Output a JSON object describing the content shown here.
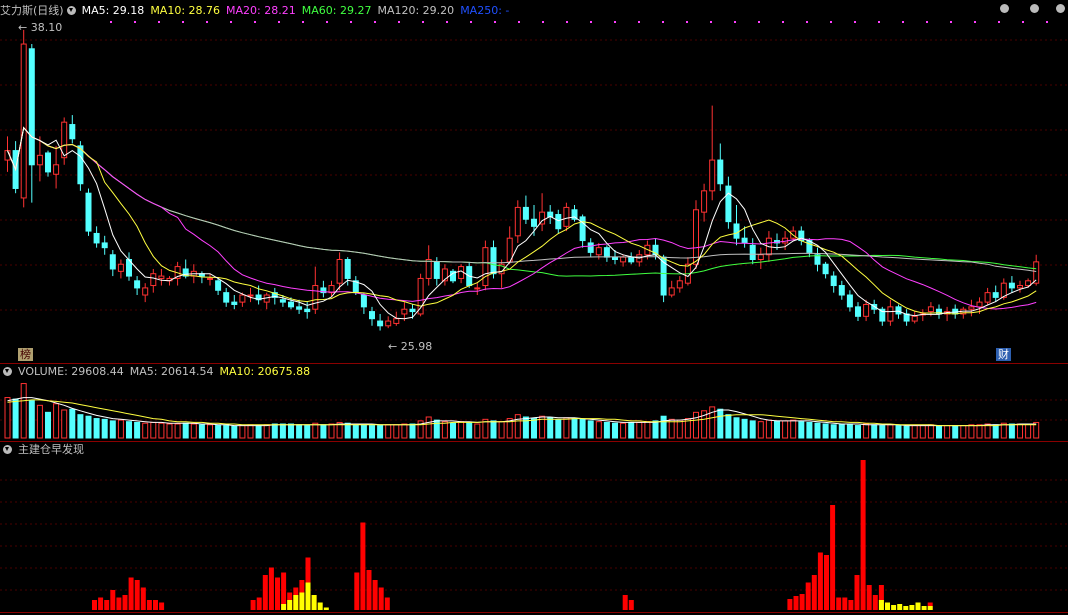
{
  "title": "艾力斯(日线)",
  "ma_legend": [
    {
      "label": "MA5: 29.18",
      "color": "#ffffff"
    },
    {
      "label": "MA10: 28.76",
      "color": "#ffff40"
    },
    {
      "label": "MA20: 28.21",
      "color": "#ff40ff"
    },
    {
      "label": "MA60: 29.27",
      "color": "#40ff40"
    },
    {
      "label": "MA120: 29.20",
      "color": "#c0c0c0"
    },
    {
      "label": "MA250: -",
      "color": "#2050ff"
    }
  ],
  "price_high": "38.10",
  "price_low": "25.98",
  "badge_left": "榜",
  "badge_right": "财",
  "volume_legend": [
    {
      "label": "VOLUME: 29608.44",
      "color": "#c0c0c0"
    },
    {
      "label": "MA5: 20614.54",
      "color": "#c0c0c0"
    },
    {
      "label": "MA10: 20675.88",
      "color": "#ffff40"
    }
  ],
  "indicator_title": "主建仓早发现",
  "colors": {
    "up": "#ff3232",
    "down": "#54ffff",
    "ind_red": "#ff0000",
    "ind_yellow": "#ffff00"
  },
  "chart_data": {
    "type": "candlestick",
    "ohlc": [
      [
        32.6,
        33.6,
        32.1,
        33.0
      ],
      [
        33.0,
        33.4,
        31.2,
        31.4
      ],
      [
        31.0,
        38.1,
        30.6,
        37.5
      ],
      [
        37.3,
        37.5,
        30.8,
        32.4
      ],
      [
        32.4,
        33.6,
        31.7,
        32.8
      ],
      [
        32.9,
        33.0,
        31.9,
        32.1
      ],
      [
        32.0,
        33.2,
        31.4,
        32.4
      ],
      [
        32.7,
        34.4,
        32.4,
        34.2
      ],
      [
        34.1,
        34.5,
        33.3,
        33.5
      ],
      [
        33.2,
        33.4,
        31.3,
        31.6
      ],
      [
        31.2,
        31.4,
        29.4,
        29.6
      ],
      [
        29.5,
        29.8,
        28.9,
        29.1
      ],
      [
        29.1,
        29.4,
        28.6,
        28.9
      ],
      [
        28.6,
        28.8,
        27.7,
        28.0
      ],
      [
        27.9,
        28.4,
        27.6,
        28.2
      ],
      [
        28.4,
        28.7,
        27.5,
        27.7
      ],
      [
        27.5,
        27.7,
        26.9,
        27.2
      ],
      [
        26.9,
        27.4,
        26.6,
        27.2
      ],
      [
        27.3,
        28.0,
        27.0,
        27.8
      ],
      [
        27.6,
        28.0,
        27.3,
        27.7
      ],
      [
        27.5,
        27.7,
        27.3,
        27.6
      ],
      [
        27.6,
        28.3,
        27.3,
        28.1
      ],
      [
        28.0,
        28.4,
        27.6,
        27.7
      ],
      [
        27.7,
        28.2,
        27.4,
        27.9
      ],
      [
        27.8,
        27.9,
        27.4,
        27.7
      ],
      [
        27.6,
        27.8,
        27.3,
        27.6
      ],
      [
        27.5,
        27.6,
        26.9,
        27.1
      ],
      [
        27.0,
        27.2,
        26.4,
        26.6
      ],
      [
        26.6,
        26.9,
        26.3,
        26.5
      ],
      [
        26.6,
        27.0,
        26.4,
        26.9
      ],
      [
        26.9,
        27.2,
        26.6,
        26.9
      ],
      [
        26.9,
        27.3,
        26.5,
        26.7
      ],
      [
        26.6,
        27.0,
        26.3,
        26.9
      ],
      [
        27.0,
        27.2,
        26.5,
        26.8
      ],
      [
        26.7,
        26.9,
        26.4,
        26.6
      ],
      [
        26.6,
        26.8,
        26.3,
        26.4
      ],
      [
        26.4,
        26.7,
        26.1,
        26.3
      ],
      [
        26.3,
        26.6,
        25.9,
        26.2
      ],
      [
        26.3,
        28.1,
        26.1,
        27.3
      ],
      [
        27.2,
        27.5,
        26.8,
        27.0
      ],
      [
        27.0,
        27.5,
        26.8,
        27.3
      ],
      [
        27.4,
        28.7,
        27.1,
        28.4
      ],
      [
        28.4,
        28.5,
        27.3,
        27.6
      ],
      [
        27.5,
        27.7,
        26.9,
        27.0
      ],
      [
        26.9,
        27.0,
        26.1,
        26.4
      ],
      [
        26.2,
        26.4,
        25.6,
        25.9
      ],
      [
        25.8,
        26.1,
        25.4,
        25.6
      ],
      [
        25.6,
        26.0,
        25.5,
        25.8
      ],
      [
        25.7,
        26.2,
        25.6,
        25.9
      ],
      [
        26.1,
        26.6,
        25.8,
        26.3
      ],
      [
        26.3,
        26.5,
        25.9,
        26.2
      ],
      [
        26.1,
        27.8,
        26.0,
        27.6
      ],
      [
        27.6,
        29.0,
        27.3,
        28.4
      ],
      [
        28.3,
        28.5,
        27.3,
        27.6
      ],
      [
        27.5,
        28.2,
        27.3,
        28.0
      ],
      [
        27.9,
        28.0,
        27.4,
        27.5
      ],
      [
        27.6,
        28.2,
        27.4,
        28.1
      ],
      [
        28.1,
        28.3,
        27.2,
        27.3
      ],
      [
        27.2,
        27.4,
        26.9,
        27.2
      ],
      [
        27.3,
        29.2,
        27.1,
        28.9
      ],
      [
        28.9,
        29.2,
        27.6,
        27.8
      ],
      [
        27.8,
        28.4,
        27.2,
        28.2
      ],
      [
        28.3,
        29.8,
        28.2,
        29.3
      ],
      [
        29.4,
        30.9,
        29.1,
        30.6
      ],
      [
        30.6,
        31.1,
        29.9,
        30.1
      ],
      [
        30.1,
        30.7,
        29.4,
        29.8
      ],
      [
        29.9,
        31.2,
        29.6,
        30.4
      ],
      [
        30.4,
        30.7,
        29.9,
        30.2
      ],
      [
        30.3,
        30.5,
        29.5,
        29.7
      ],
      [
        29.8,
        30.8,
        29.6,
        30.6
      ],
      [
        30.5,
        30.7,
        30.0,
        30.1
      ],
      [
        30.2,
        30.3,
        28.9,
        29.2
      ],
      [
        29.1,
        29.3,
        28.5,
        28.7
      ],
      [
        28.6,
        29.1,
        28.4,
        28.9
      ],
      [
        28.9,
        29.0,
        28.3,
        28.5
      ],
      [
        28.5,
        28.8,
        28.2,
        28.4
      ],
      [
        28.3,
        28.6,
        28.1,
        28.5
      ],
      [
        28.5,
        28.7,
        28.2,
        28.3
      ],
      [
        28.3,
        28.8,
        28.1,
        28.6
      ],
      [
        28.6,
        29.2,
        28.4,
        29.0
      ],
      [
        29.0,
        29.3,
        28.4,
        28.6
      ],
      [
        28.5,
        28.6,
        26.6,
        26.9
      ],
      [
        26.9,
        27.5,
        26.8,
        27.2
      ],
      [
        27.2,
        27.7,
        27.0,
        27.5
      ],
      [
        27.4,
        28.5,
        27.3,
        28.2
      ],
      [
        28.2,
        30.9,
        28.0,
        30.5
      ],
      [
        30.4,
        31.6,
        30.0,
        31.3
      ],
      [
        31.3,
        34.9,
        30.9,
        32.6
      ],
      [
        32.6,
        33.3,
        31.3,
        31.6
      ],
      [
        31.5,
        31.9,
        29.7,
        30.0
      ],
      [
        29.9,
        30.7,
        29.0,
        29.3
      ],
      [
        29.3,
        29.8,
        28.9,
        29.1
      ],
      [
        29.0,
        29.3,
        28.2,
        28.4
      ],
      [
        28.4,
        28.9,
        28.0,
        28.6
      ],
      [
        28.6,
        29.6,
        28.3,
        29.3
      ],
      [
        29.2,
        29.5,
        28.8,
        29.1
      ],
      [
        29.1,
        29.6,
        28.8,
        29.3
      ],
      [
        29.3,
        29.8,
        29.2,
        29.6
      ],
      [
        29.6,
        29.8,
        29.0,
        29.2
      ],
      [
        29.2,
        29.3,
        28.5,
        28.7
      ],
      [
        28.6,
        28.9,
        27.9,
        28.2
      ],
      [
        28.2,
        28.3,
        27.6,
        27.8
      ],
      [
        27.7,
        27.9,
        27.0,
        27.3
      ],
      [
        27.3,
        27.5,
        26.7,
        26.9
      ],
      [
        26.9,
        27.1,
        26.2,
        26.4
      ],
      [
        26.4,
        26.6,
        25.8,
        26.0
      ],
      [
        26.0,
        26.7,
        25.8,
        26.5
      ],
      [
        26.5,
        26.7,
        26.1,
        26.3
      ],
      [
        26.3,
        26.4,
        25.6,
        25.8
      ],
      [
        25.8,
        26.7,
        25.6,
        26.4
      ],
      [
        26.4,
        26.5,
        25.9,
        26.1
      ],
      [
        26.1,
        26.3,
        25.6,
        25.8
      ],
      [
        25.8,
        26.2,
        25.7,
        26.0
      ],
      [
        26.1,
        26.3,
        25.8,
        26.1
      ],
      [
        26.2,
        26.6,
        26.0,
        26.4
      ],
      [
        26.3,
        26.5,
        25.9,
        26.1
      ],
      [
        26.1,
        26.4,
        25.8,
        26.2
      ],
      [
        26.3,
        26.5,
        25.9,
        26.1
      ],
      [
        26.1,
        26.4,
        25.9,
        26.3
      ],
      [
        26.3,
        26.7,
        26.0,
        26.4
      ],
      [
        26.4,
        26.8,
        26.1,
        26.6
      ],
      [
        26.6,
        27.2,
        26.5,
        27.0
      ],
      [
        27.0,
        27.3,
        26.6,
        26.8
      ],
      [
        26.8,
        27.6,
        26.7,
        27.4
      ],
      [
        27.4,
        27.7,
        27.0,
        27.2
      ],
      [
        27.2,
        27.5,
        27.0,
        27.3
      ],
      [
        27.3,
        27.6,
        27.2,
        27.5
      ],
      [
        27.4,
        28.6,
        27.3,
        28.3
      ]
    ],
    "volume": [
      52,
      50,
      70,
      48,
      42,
      33,
      44,
      36,
      37,
      30,
      28,
      25,
      24,
      22,
      23,
      21,
      20,
      19,
      20,
      19,
      18,
      18,
      19,
      18,
      17,
      17,
      16,
      16,
      15,
      16,
      17,
      16,
      17,
      18,
      18,
      18,
      17,
      16,
      19,
      17,
      18,
      20,
      19,
      18,
      17,
      16,
      16,
      17,
      17,
      18,
      18,
      22,
      27,
      23,
      21,
      19,
      21,
      20,
      18,
      24,
      22,
      21,
      25,
      30,
      27,
      25,
      28,
      26,
      23,
      26,
      25,
      24,
      22,
      21,
      20,
      19,
      19,
      20,
      20,
      21,
      22,
      28,
      24,
      23,
      25,
      33,
      35,
      40,
      37,
      30,
      26,
      24,
      22,
      21,
      23,
      22,
      22,
      23,
      21,
      20,
      19,
      18,
      17,
      18,
      17,
      16,
      18,
      17,
      16,
      17,
      16,
      15,
      16,
      16,
      17,
      16,
      16,
      16,
      16,
      17,
      17,
      18,
      17,
      19,
      18,
      18,
      18,
      20
    ],
    "volume_ma5": [
      48,
      50,
      52,
      52,
      50,
      48,
      45,
      42,
      38,
      35,
      32,
      29,
      27,
      25,
      24,
      23,
      22,
      21,
      20,
      20,
      19,
      19,
      19,
      19,
      18,
      18,
      17,
      17,
      16,
      16,
      16,
      16,
      16,
      17,
      17,
      17,
      17,
      17,
      17,
      17,
      17,
      18,
      18,
      18,
      18,
      18,
      17,
      17,
      17,
      17,
      17,
      18,
      20,
      22,
      22,
      22,
      21,
      21,
      20,
      21,
      21,
      21,
      22,
      24,
      25,
      26,
      27,
      27,
      26,
      26,
      26,
      25,
      24,
      23,
      22,
      21,
      20,
      20,
      20,
      20,
      20,
      22,
      23,
      23,
      24,
      26,
      29,
      33,
      36,
      36,
      34,
      31,
      28,
      25,
      23,
      22,
      22,
      22,
      22,
      22,
      21,
      20,
      19,
      18,
      18,
      18,
      17,
      17,
      17,
      17,
      17,
      16,
      16,
      16,
      16,
      16,
      16,
      16,
      16,
      16,
      16,
      17,
      17,
      17,
      17,
      18,
      18,
      18
    ],
    "volume_ma10": [
      46,
      47,
      48,
      49,
      49,
      48,
      47,
      46,
      45,
      43,
      41,
      39,
      37,
      35,
      33,
      31,
      29,
      27,
      25,
      24,
      22,
      21,
      21,
      20,
      20,
      19,
      19,
      18,
      18,
      17,
      17,
      17,
      17,
      17,
      17,
      17,
      17,
      17,
      17,
      17,
      17,
      17,
      17,
      17,
      17,
      17,
      17,
      17,
      17,
      17,
      17,
      17,
      18,
      19,
      19,
      20,
      20,
      20,
      20,
      21,
      21,
      21,
      21,
      22,
      22,
      23,
      24,
      24,
      24,
      24,
      25,
      25,
      25,
      25,
      24,
      24,
      23,
      22,
      22,
      21,
      21,
      21,
      21,
      21,
      22,
      23,
      24,
      26,
      28,
      29,
      30,
      30,
      30,
      30,
      29,
      28,
      27,
      26,
      25,
      24,
      23,
      22,
      21,
      21,
      20,
      20,
      19,
      19,
      18,
      18,
      17,
      17,
      17,
      17,
      17,
      16,
      16,
      16,
      16,
      16,
      16,
      16,
      16,
      17,
      17,
      17,
      17,
      17
    ],
    "indicator": [
      {
        "i": 18,
        "v": 2,
        "c": "r"
      },
      {
        "i": 19,
        "v": 2.5,
        "c": "r"
      },
      {
        "i": 20,
        "v": 2,
        "c": "r"
      },
      {
        "i": 21,
        "v": 4,
        "c": "r"
      },
      {
        "i": 22,
        "v": 2.5,
        "c": "r"
      },
      {
        "i": 23,
        "v": 3,
        "c": "r"
      },
      {
        "i": 24,
        "v": 6.5,
        "c": "r"
      },
      {
        "i": 25,
        "v": 6,
        "c": "r"
      },
      {
        "i": 26,
        "v": 4.5,
        "c": "r"
      },
      {
        "i": 27,
        "v": 2,
        "c": "r"
      },
      {
        "i": 28,
        "v": 2,
        "c": "r"
      },
      {
        "i": 29,
        "v": 1.5,
        "c": "r"
      },
      {
        "i": 44,
        "v": 2,
        "c": "r"
      },
      {
        "i": 45,
        "v": 2.5,
        "c": "r"
      },
      {
        "i": 46,
        "v": 7,
        "c": "r"
      },
      {
        "i": 47,
        "v": 8.5,
        "c": "r"
      },
      {
        "i": 48,
        "v": 6.5,
        "c": "r"
      },
      {
        "i": 49,
        "v": 7.5,
        "c": "r",
        "y": 1.2
      },
      {
        "i": 50,
        "v": 3.5,
        "c": "r",
        "y": 2
      },
      {
        "i": 51,
        "v": 4.5,
        "c": "r",
        "y": 3
      },
      {
        "i": 52,
        "v": 6,
        "c": "r",
        "y": 3.5
      },
      {
        "i": 53,
        "v": 10.5,
        "c": "r",
        "y": 5.5
      },
      {
        "i": 54,
        "v": 3,
        "c": "r",
        "y": 3
      },
      {
        "i": 55,
        "v": 1.5,
        "c": "y",
        "y": 1.5
      },
      {
        "i": 56,
        "v": 0.5,
        "c": "y",
        "y": 0.5
      },
      {
        "i": 61,
        "v": 7.5,
        "c": "r"
      },
      {
        "i": 62,
        "v": 17.5,
        "c": "r"
      },
      {
        "i": 63,
        "v": 8,
        "c": "r"
      },
      {
        "i": 64,
        "v": 6,
        "c": "r"
      },
      {
        "i": 65,
        "v": 4.5,
        "c": "r"
      },
      {
        "i": 66,
        "v": 2.5,
        "c": "r"
      },
      {
        "i": 105,
        "v": 3,
        "c": "r"
      },
      {
        "i": 106,
        "v": 2,
        "c": "r"
      },
      {
        "i": 132,
        "v": 2.2,
        "c": "r"
      },
      {
        "i": 133,
        "v": 2.8,
        "c": "r"
      },
      {
        "i": 134,
        "v": 3.2,
        "c": "r"
      },
      {
        "i": 135,
        "v": 5.5,
        "c": "r"
      },
      {
        "i": 136,
        "v": 7,
        "c": "r"
      },
      {
        "i": 137,
        "v": 11.5,
        "c": "r"
      },
      {
        "i": 138,
        "v": 11,
        "c": "r"
      },
      {
        "i": 139,
        "v": 21,
        "c": "r"
      },
      {
        "i": 140,
        "v": 2.5,
        "c": "r"
      },
      {
        "i": 141,
        "v": 2.5,
        "c": "r"
      },
      {
        "i": 142,
        "v": 2,
        "c": "r"
      },
      {
        "i": 143,
        "v": 7,
        "c": "r"
      },
      {
        "i": 144,
        "v": 30,
        "c": "r"
      },
      {
        "i": 145,
        "v": 5,
        "c": "r"
      },
      {
        "i": 146,
        "v": 3,
        "c": "r"
      },
      {
        "i": 147,
        "v": 5,
        "c": "r",
        "y": 2
      },
      {
        "i": 148,
        "v": 1.5,
        "c": "y",
        "y": 1.5
      },
      {
        "i": 149,
        "v": 1,
        "c": "y",
        "y": 1
      },
      {
        "i": 150,
        "v": 1.2,
        "c": "y",
        "y": 1.2
      },
      {
        "i": 151,
        "v": 0.8,
        "c": "y",
        "y": 0.8
      },
      {
        "i": 152,
        "v": 1,
        "c": "y",
        "y": 1
      },
      {
        "i": 153,
        "v": 1.5,
        "c": "y",
        "y": 1.5
      },
      {
        "i": 154,
        "v": 0.8,
        "c": "y",
        "y": 0.8
      },
      {
        "i": 155,
        "v": 1.5,
        "c": "r",
        "y": 0.8
      }
    ]
  }
}
